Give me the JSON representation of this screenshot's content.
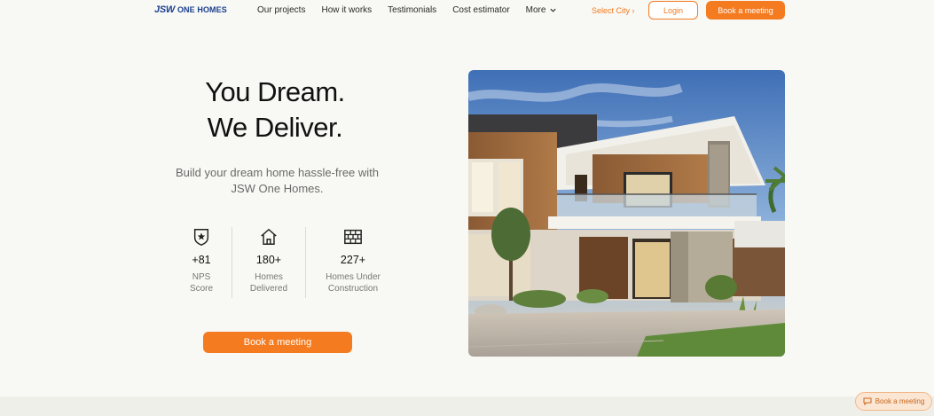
{
  "header": {
    "logo_mark": "JSW",
    "logo_text": "ONE HOMES",
    "nav": [
      "Our projects",
      "How it works",
      "Testimonials",
      "Cost estimator",
      "More"
    ],
    "city": "Select City ›",
    "login": "Login",
    "book": "Book a meeting"
  },
  "hero": {
    "title_line1": "You Dream.",
    "title_line2": "We Deliver.",
    "subtitle": "Build your dream home hassle-free with JSW One Homes.",
    "cta": "Book a meeting"
  },
  "stats": [
    {
      "value": "+81",
      "label1": "NPS",
      "label2": "Score",
      "icon": "shield-star-icon"
    },
    {
      "value": "180+",
      "label1": "Homes",
      "label2": "Delivered",
      "icon": "house-icon"
    },
    {
      "value": "227+",
      "label1": "Homes Under",
      "label2": "Construction",
      "icon": "brick-wall-icon"
    }
  ],
  "floating": {
    "label": "Book a meeting",
    "icon": "chat-icon"
  },
  "colors": {
    "accent": "#f47b20",
    "brand": "#1b3f8f",
    "background": "#f8f8f4"
  }
}
